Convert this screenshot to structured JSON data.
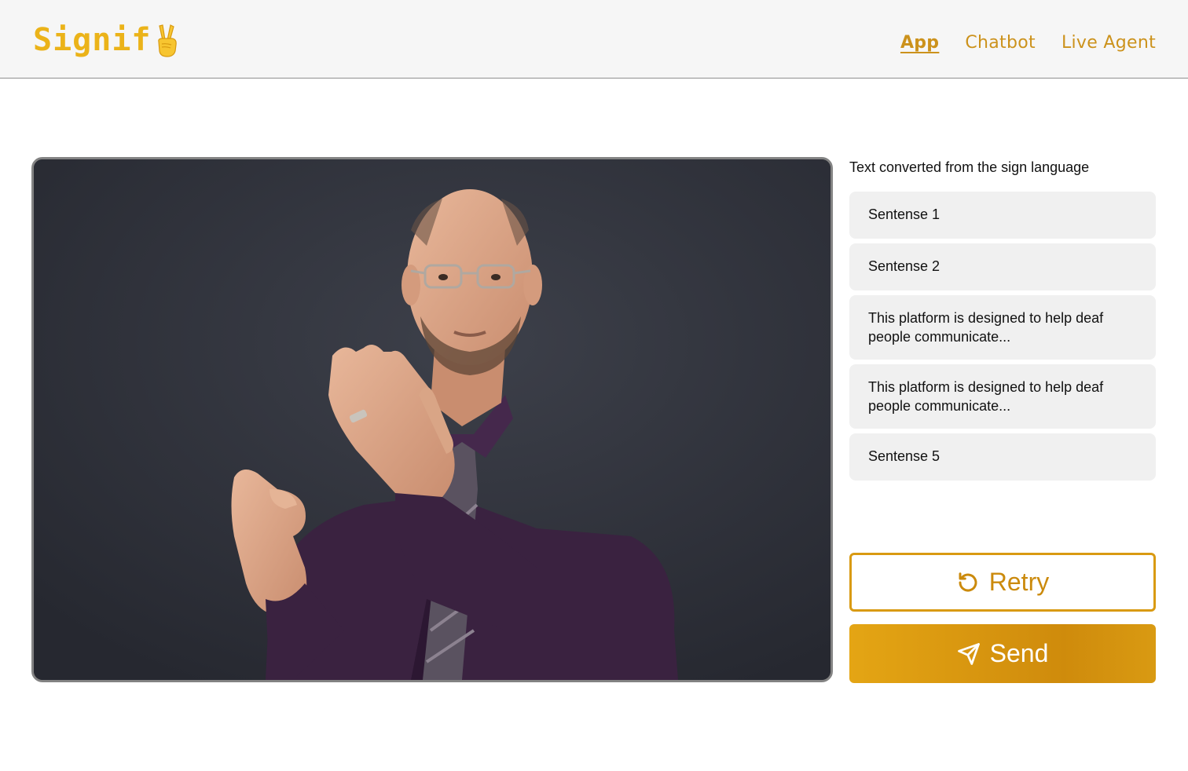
{
  "header": {
    "logo_text": "Signif",
    "logo_icon": "victory-hand-emoji",
    "nav": [
      {
        "label": "App",
        "active": true
      },
      {
        "label": "Chatbot",
        "active": false
      },
      {
        "label": "Live Agent",
        "active": false
      }
    ]
  },
  "video": {
    "description_icon": "video-feed"
  },
  "panel": {
    "title": "Text converted from the sign language",
    "sentences": [
      "Sentense 1",
      "Sentense 2",
      "This platform is designed to help deaf people communicate...",
      "This platform is designed to help deaf people communicate...",
      "Sentense 5"
    ]
  },
  "actions": {
    "retry_label": "Retry",
    "retry_icon": "rotate-ccw-icon",
    "send_label": "Send",
    "send_icon": "send-icon"
  },
  "colors": {
    "brand": "#ebb319",
    "accent": "#d99a12",
    "nav": "#cc921c"
  }
}
